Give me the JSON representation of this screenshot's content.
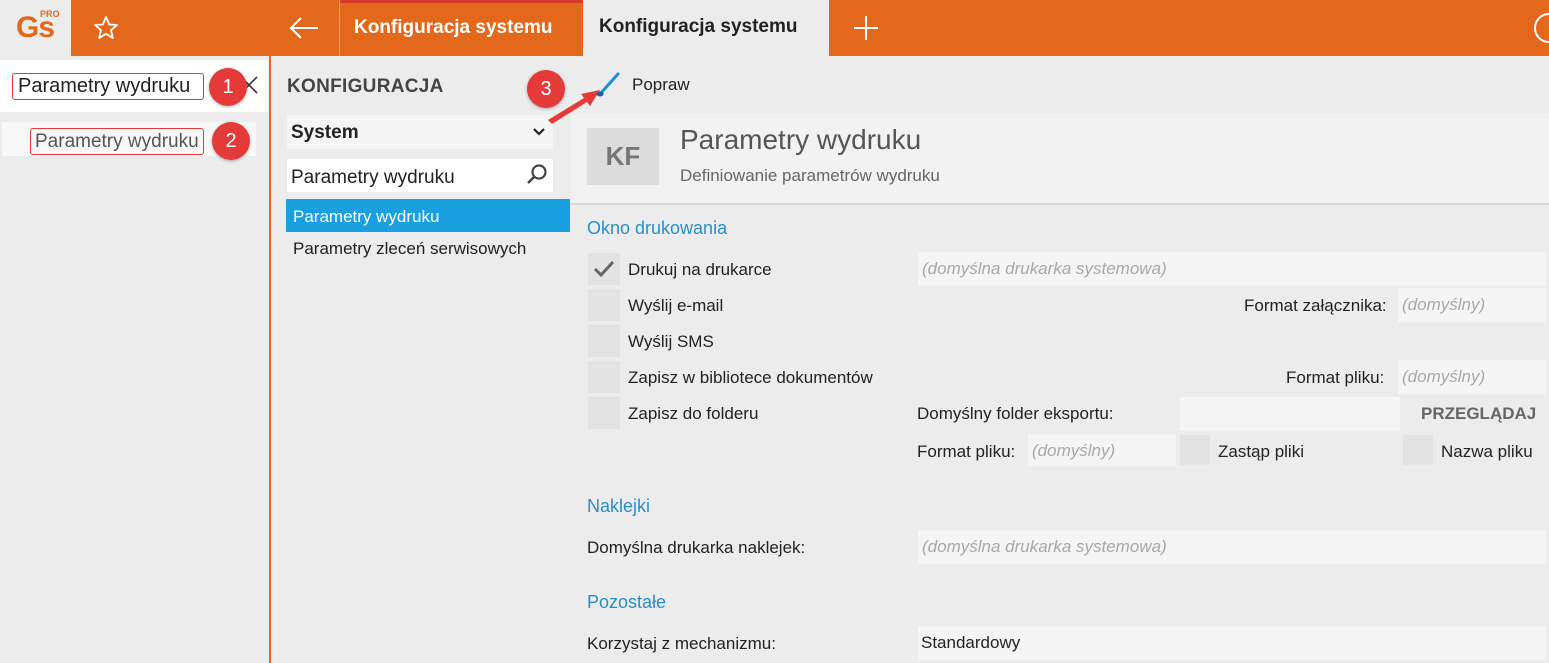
{
  "app": {
    "logo_text": "Gs",
    "logo_sup": "PRO"
  },
  "tabs": [
    {
      "label": "Konfiguracja systemu",
      "active": false
    },
    {
      "label": "Konfiguracja systemu",
      "active": true
    }
  ],
  "left_search": {
    "value": "Parametry wydruku"
  },
  "left_results": [
    {
      "label": "Parametry wydruku"
    }
  ],
  "annotations": {
    "b1": "1",
    "b2": "2",
    "b3": "3"
  },
  "middle": {
    "title": "KONFIGURACJA",
    "select_value": "System",
    "search_value": "Parametry wydruku",
    "nav_items": [
      {
        "label": "Parametry wydruku",
        "selected": true
      },
      {
        "label": "Parametry zleceń serwisowych",
        "selected": false
      }
    ]
  },
  "toolbar": {
    "popraw_label": "Popraw"
  },
  "header": {
    "icon_text": "KF",
    "title": "Parametry wydruku",
    "subtitle": "Definiowanie parametrów wydruku"
  },
  "okno": {
    "section_title": "Okno drukowania",
    "print_checked": true,
    "print_label": "Drukuj na drukarce",
    "printer_placeholder": "(domyślna drukarka systemowa)",
    "email_label": "Wyślij e-mail",
    "attachment_format_label": "Format załącznika:",
    "attachment_format_placeholder": "(domyślny)",
    "sms_label": "Wyślij SMS",
    "library_label": "Zapisz w bibliotece dokumentów",
    "file_format_label": "Format pliku:",
    "file_format_placeholder": "(domyślny)",
    "folder_label": "Zapisz do folderu",
    "export_folder_label": "Domyślny folder eksportu:",
    "browse_label": "PRZEGLĄDAJ",
    "folder_format_label": "Format pliku:",
    "folder_format_placeholder": "(domyślny)",
    "replace_label": "Zastąp pliki",
    "filename_label": "Nazwa pliku"
  },
  "naklejki": {
    "section_title": "Naklejki",
    "printer_label": "Domyślna drukarka naklejek:",
    "printer_placeholder": "(domyślna drukarka systemowa)"
  },
  "pozostale": {
    "section_title": "Pozostałe",
    "mechanism_label": "Korzystaj z mechanizmu:",
    "mechanism_value": "Standardowy"
  },
  "colors": {
    "accent": "#e4681c",
    "selection": "#1a9fe0",
    "section": "#2a8fc8",
    "annotation": "#e53a3a"
  },
  "icons": [
    "star-icon",
    "back-arrow-icon",
    "plus-icon",
    "close-icon",
    "chevron-down-icon",
    "search-icon",
    "brush-icon",
    "check-icon"
  ]
}
